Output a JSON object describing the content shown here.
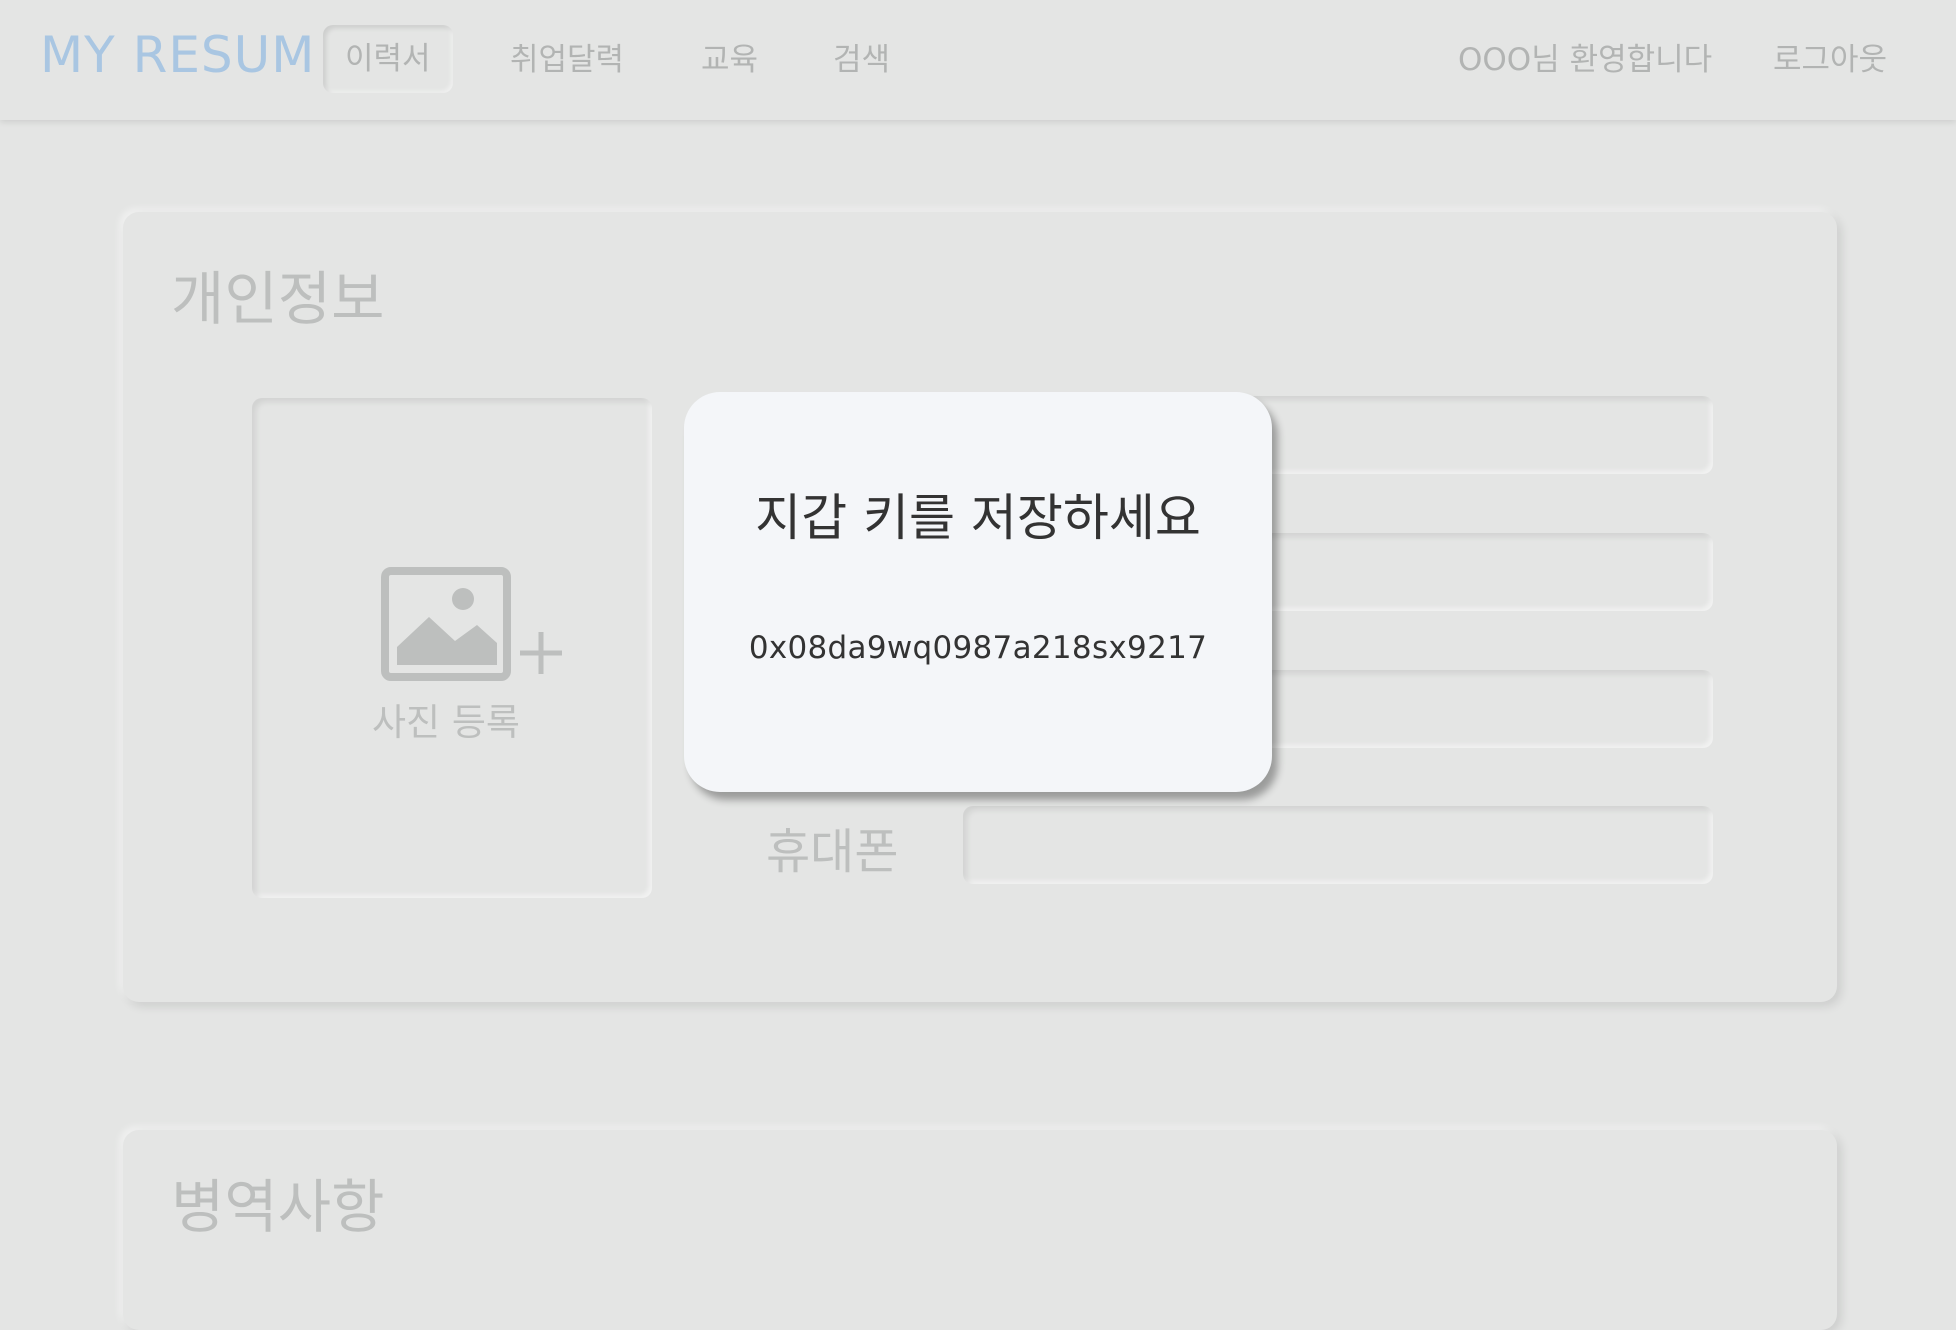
{
  "header": {
    "logo": "MY RESUM",
    "nav": [
      "이력서",
      "취업달력",
      "교육",
      "검색"
    ],
    "active_nav": "이력서",
    "welcome": "OOO님 환영합니다",
    "logout": "로그아웃"
  },
  "personal_info": {
    "title": "개인정보",
    "photo_label": "사진 등록",
    "phone_label": "휴대폰"
  },
  "military": {
    "title": "병역사항"
  },
  "modal": {
    "title": "지갑 키를 저장하세요",
    "wallet_key": "0x08da9wq0987a218sx9217"
  },
  "colors": {
    "background": "#e4e5e4",
    "logo": "#a9c6e2",
    "muted_text": "#b2b4b3",
    "modal_bg": "#f4f6f9",
    "modal_text": "#333333"
  },
  "icons": {
    "photo": "image-placeholder-icon",
    "add": "plus-icon"
  }
}
